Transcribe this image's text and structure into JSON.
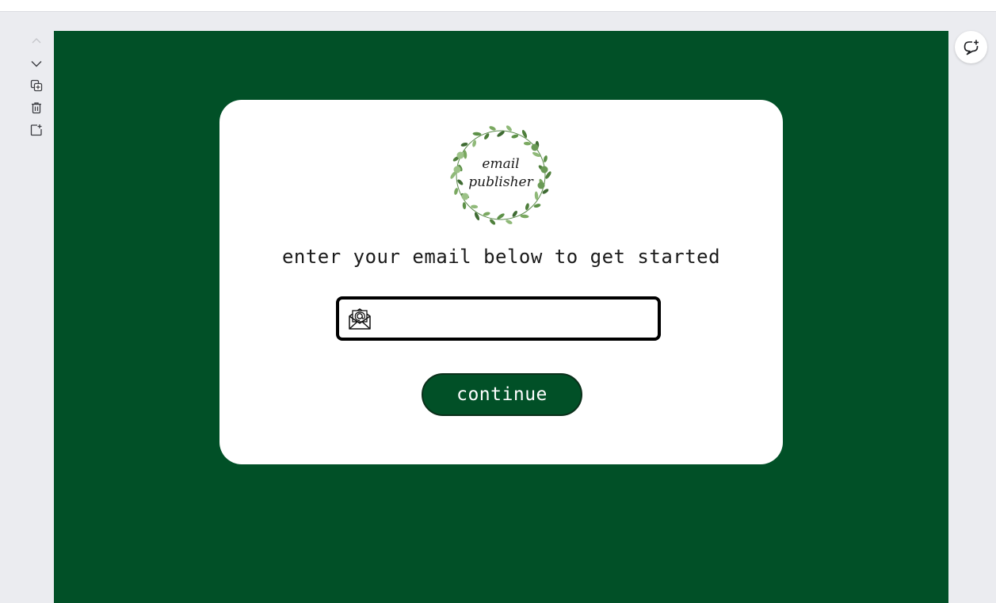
{
  "editor": {
    "tools": [
      {
        "name": "move-up",
        "icon": "chevron-up-icon",
        "disabled": true
      },
      {
        "name": "move-down",
        "icon": "chevron-down-icon"
      },
      {
        "name": "duplicate",
        "icon": "duplicate-icon"
      },
      {
        "name": "delete",
        "icon": "trash-icon"
      },
      {
        "name": "add-page",
        "icon": "add-page-icon"
      }
    ],
    "comment_icon": "comment-add-icon"
  },
  "card": {
    "logo": {
      "line1": "email",
      "line2": "publisher"
    },
    "heading": "enter your email below to get started",
    "email_input": {
      "value": "",
      "placeholder": "",
      "icon": "envelope-at-icon"
    },
    "continue_label": "continue"
  },
  "colors": {
    "background": "#015027",
    "card": "#ffffff",
    "button": "#015027",
    "editor_bg": "#ebecf0"
  }
}
